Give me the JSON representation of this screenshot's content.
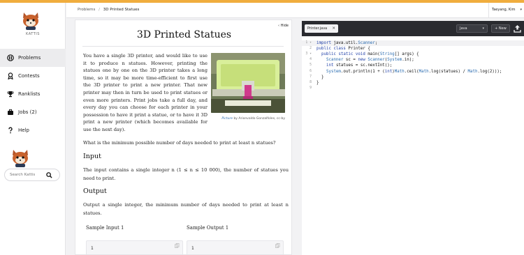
{
  "sidebar": {
    "logo_caption": "KATTIS",
    "nav": [
      {
        "label": "Problems",
        "icon": "problems-icon",
        "active": true
      },
      {
        "label": "Contests",
        "icon": "contests-icon"
      },
      {
        "label": "Ranklists",
        "icon": "trophy-icon"
      },
      {
        "label": "Jobs (2)",
        "icon": "briefcase-icon"
      },
      {
        "label": "Help",
        "icon": "help-icon"
      }
    ],
    "search_placeholder": "Search Kattis"
  },
  "topbar": {
    "breadcrumb": [
      "Problems",
      "3D Printed Statues"
    ],
    "user_name": "Taeyang, Kim"
  },
  "problem": {
    "hide_label": "Hide",
    "title": "3D Printed Statues",
    "intro": "You have a single 3D printer, and would like to use it to produce n statues. However, printing the statues one by one on the 3D printer takes a long time, so it may be more time-efficient to first use the 3D printer to print a new printer. That new printer may then in turn be used to print statues or even more printers. Print jobs take a full day, and every day you can choose for each printer in your possession to have it print a statue, or to have it 3D print a new printer (which becomes available for use the next day).",
    "figure_caption_prefix": "Picture",
    "figure_caption_author": "by Arionvaldo Gonzalfoles, cc-by",
    "question": "What is the minimum possible number of days needed to print at least n statues?",
    "input_heading": "Input",
    "input_text": "The input contains a single integer n (1 ≤ n ≤ 10 000), the number of statues you need to print.",
    "output_heading": "Output",
    "output_text": "Output a single integer, the minimum number of days needed to print at least n statues.",
    "sample_input_label": "Sample Input 1",
    "sample_output_label": "Sample Output 1",
    "sample_input_value": "1",
    "sample_output_value": "1"
  },
  "editor": {
    "file_tab": "Printer.java",
    "language": "Java",
    "new_button": "+ New",
    "line_numbers": [
      "1",
      "2",
      "3",
      "4",
      "5",
      "6",
      "7",
      "8",
      "9"
    ],
    "fold_markers": [
      "▾",
      "",
      "▾",
      "",
      "",
      "",
      "",
      "",
      ""
    ],
    "code_lines": [
      "import java.util.Scanner;",
      "public class Printer {",
      "  public static void main(String[] args) {",
      "    Scanner sc = new Scanner(System.in);",
      "    int statues = sc.nextInt();",
      "    System.out.println(1 + (int)Math.ceil(Math.log(statues) / Math.log(2)));",
      "  }",
      "}",
      ""
    ]
  },
  "colors": {
    "accent": "#f0ad3e",
    "editor_bar": "#2a2b30",
    "keyword": "#1f3fa8"
  }
}
